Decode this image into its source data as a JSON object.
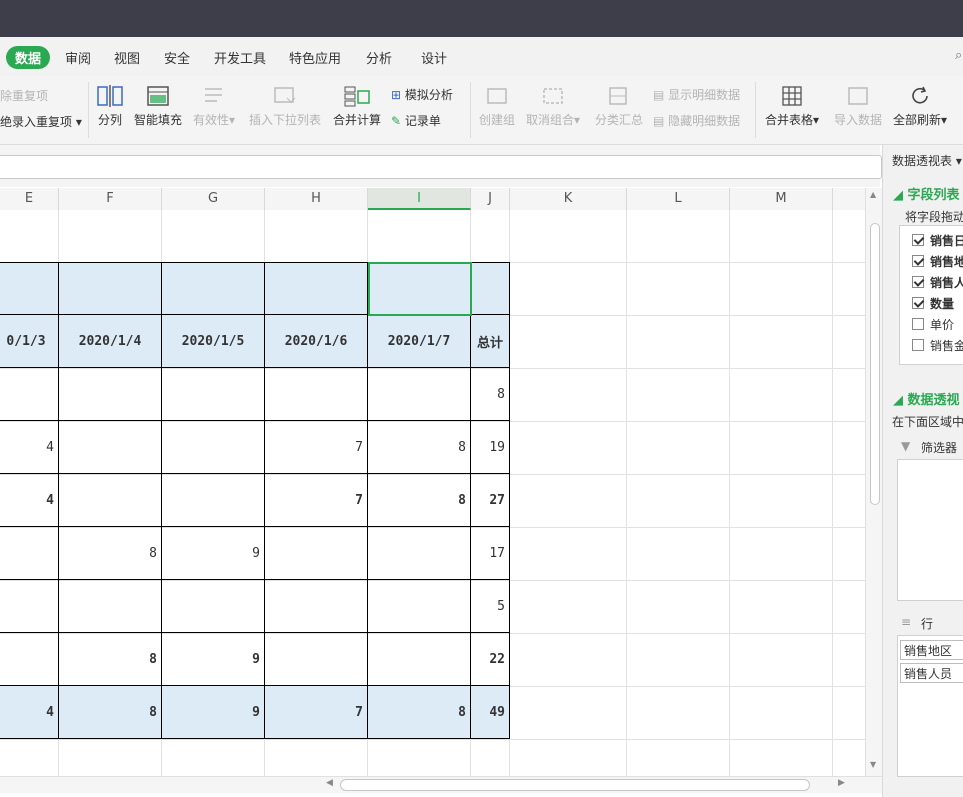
{
  "menu": [
    "数据",
    "审阅",
    "视图",
    "安全",
    "开发工具",
    "特色应用",
    "分析",
    "设计"
  ],
  "ribbon": {
    "remove_dup": "除重复项",
    "reject_dup": "拒绝录入重复项",
    "split": "分列",
    "smart_fill": "智能填充",
    "validity": "有效性",
    "insert_dropdown": "插入下拉列表",
    "consolidate": "合并计算",
    "what_if": "模拟分析",
    "record_form": "记录单",
    "create_group": "创建组",
    "ungroup": "取消组合",
    "subtotal": "分类汇总",
    "show_detail": "显示明细数据",
    "hide_detail": "隐藏明细数据",
    "merge_tables": "合并表格",
    "import_data": "导入数据",
    "refresh_all": "全部刷新"
  },
  "columns": [
    "E",
    "F",
    "G",
    "H",
    "I",
    "J",
    "K",
    "L",
    "M"
  ],
  "table": {
    "header": [
      "0/1/3",
      "2020/1/4",
      "2020/1/5",
      "2020/1/6",
      "2020/1/7",
      "总计"
    ],
    "rows": [
      {
        "bold": false,
        "vals": [
          "",
          "",
          "",
          "",
          "",
          "8"
        ]
      },
      {
        "bold": false,
        "vals": [
          "4",
          "",
          "",
          "7",
          "8",
          "19"
        ]
      },
      {
        "bold": true,
        "vals": [
          "4",
          "",
          "",
          "7",
          "8",
          "27"
        ]
      },
      {
        "bold": false,
        "vals": [
          "",
          "8",
          "9",
          "",
          "",
          "17"
        ]
      },
      {
        "bold": false,
        "vals": [
          "",
          "",
          "",
          "",
          "",
          "5"
        ]
      },
      {
        "bold": true,
        "vals": [
          "",
          "8",
          "9",
          "",
          "",
          "22"
        ]
      }
    ],
    "total": [
      "4",
      "8",
      "9",
      "7",
      "8",
      "49"
    ]
  },
  "panel": {
    "title": "数据透视表",
    "field_list": "字段列表",
    "drag_hint": "将字段拖动",
    "fields": [
      {
        "label": "销售日",
        "checked": true
      },
      {
        "label": "销售地",
        "checked": true
      },
      {
        "label": "销售人",
        "checked": true
      },
      {
        "label": "数量",
        "checked": true
      },
      {
        "label": "单价",
        "checked": false
      },
      {
        "label": "销售金",
        "checked": false
      }
    ],
    "pivot_areas": "数据透视",
    "areas_hint": "在下面区域中",
    "filter": "筛选器",
    "rows_label": "行",
    "row_fields": [
      "销售地区",
      "销售人员"
    ]
  },
  "colors": {
    "accent": "#2aa952",
    "header_fill": "#ddebf7",
    "titlebar": "#3d3e4a"
  }
}
